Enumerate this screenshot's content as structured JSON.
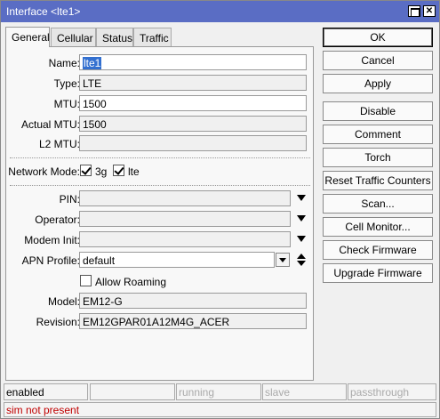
{
  "window": {
    "title": "Interface <lte1>"
  },
  "tabs": [
    {
      "label": "General",
      "active": true
    },
    {
      "label": "Cellular",
      "active": false
    },
    {
      "label": "Status",
      "active": false
    },
    {
      "label": "Traffic",
      "active": false
    }
  ],
  "form": {
    "name": {
      "label": "Name:",
      "value": "lte1"
    },
    "type": {
      "label": "Type:",
      "value": "LTE"
    },
    "mtu": {
      "label": "MTU:",
      "value": "1500"
    },
    "actual_mtu": {
      "label": "Actual MTU:",
      "value": "1500"
    },
    "l2_mtu": {
      "label": "L2 MTU:",
      "value": ""
    },
    "network_mode": {
      "label": "Network Mode:",
      "options": [
        {
          "label": "3g",
          "checked": true
        },
        {
          "label": "lte",
          "checked": true
        }
      ]
    },
    "pin": {
      "label": "PIN:",
      "value": ""
    },
    "operator": {
      "label": "Operator:",
      "value": ""
    },
    "modem_init": {
      "label": "Modem Init:",
      "value": ""
    },
    "apn_profile": {
      "label": "APN Profile:",
      "value": "default"
    },
    "allow_roaming": {
      "label": "Allow Roaming",
      "checked": false
    },
    "model": {
      "label": "Model:",
      "value": "EM12-G"
    },
    "revision": {
      "label": "Revision:",
      "value": "EM12GPAR01A12M4G_ACER"
    }
  },
  "buttons": {
    "ok": "OK",
    "cancel": "Cancel",
    "apply": "Apply",
    "disable": "Disable",
    "comment": "Comment",
    "torch": "Torch",
    "reset_traffic": "Reset Traffic Counters",
    "scan": "Scan...",
    "cell_monitor": "Cell Monitor...",
    "check_firmware": "Check Firmware",
    "upgrade_firmware": "Upgrade Firmware"
  },
  "statusbar": {
    "state": "enabled",
    "running": "running",
    "slave": "slave",
    "passthrough": "passthrough",
    "message": "sim not present"
  },
  "colors": {
    "titlebar": "#5a6dc4",
    "selection": "#3370d0",
    "error": "#c00000"
  }
}
